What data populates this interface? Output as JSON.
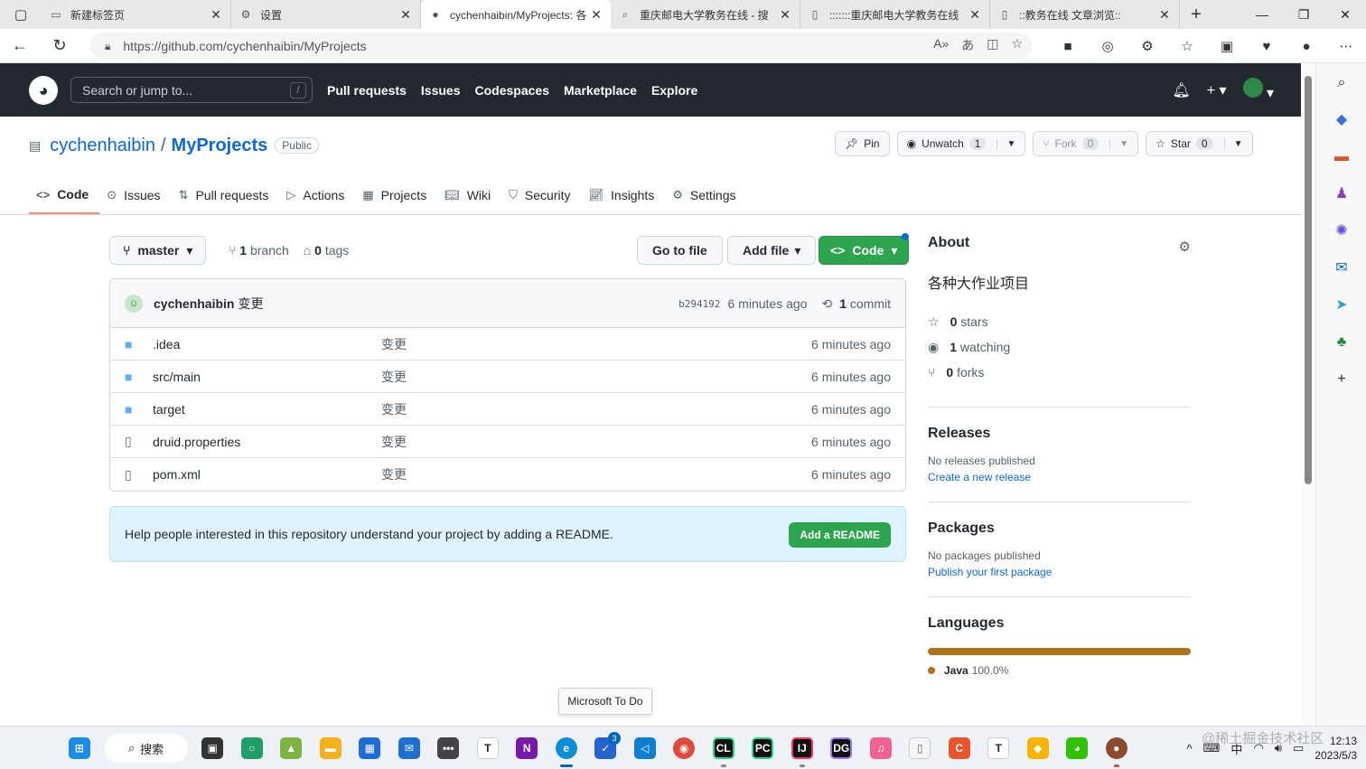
{
  "browser": {
    "tabs": [
      {
        "title": "新建标签页",
        "icon": "newtab-icon",
        "active": false
      },
      {
        "title": "设置",
        "icon": "gear-icon",
        "active": false
      },
      {
        "title": "cychenhaibin/MyProjects: 各",
        "icon": "github-icon",
        "active": true
      },
      {
        "title": "重庆邮电大学教务在线 - 搜",
        "icon": "search-icon",
        "active": false
      },
      {
        "title": ":::::::重庆邮电大学教务在线",
        "icon": "page-icon",
        "active": false
      },
      {
        "title": "::教务在线 文章浏览::",
        "icon": "page-icon",
        "active": false
      }
    ],
    "url": "https://github.com/cychenhaibin/MyProjects"
  },
  "github": {
    "search_placeholder": "Search or jump to...",
    "search_key": "/",
    "nav": [
      "Pull requests",
      "Issues",
      "Codespaces",
      "Marketplace",
      "Explore"
    ],
    "plus_label": "+"
  },
  "repo": {
    "owner": "cychenhaibin",
    "separator": "/",
    "name": "MyProjects",
    "visibility": "Public",
    "pin_label": "Pin",
    "watch_label": "Unwatch",
    "watch_count": "1",
    "fork_label": "Fork",
    "fork_count": "0",
    "star_label": "Star",
    "star_count": "0",
    "tabs": [
      "Code",
      "Issues",
      "Pull requests",
      "Actions",
      "Projects",
      "Wiki",
      "Security",
      "Insights",
      "Settings"
    ]
  },
  "code": {
    "branch": "master",
    "branch_count": "1",
    "branch_label": "branch",
    "tag_count": "0",
    "tag_label": "tags",
    "goto_label": "Go to file",
    "addfile_label": "Add file",
    "code_label": "Code",
    "commit": {
      "author": "cychenhaibin",
      "message": "变更",
      "sha": "b294192",
      "age": "6 minutes ago",
      "count": "1",
      "count_label": "commit"
    },
    "files": [
      {
        "name": ".idea",
        "type": "dir",
        "message": "变更",
        "age": "6 minutes ago"
      },
      {
        "name": "src/main",
        "type": "dir",
        "message": "变更",
        "age": "6 minutes ago"
      },
      {
        "name": "target",
        "type": "dir",
        "message": "变更",
        "age": "6 minutes ago"
      },
      {
        "name": "druid.properties",
        "type": "file",
        "message": "变更",
        "age": "6 minutes ago"
      },
      {
        "name": "pom.xml",
        "type": "file",
        "message": "变更",
        "age": "6 minutes ago"
      }
    ],
    "readme_hint": "Help people interested in this repository understand your project by adding a README.",
    "readme_button": "Add a README"
  },
  "about": {
    "title": "About",
    "description": "各种大作业项目",
    "stars": "0",
    "stars_label": "stars",
    "watching": "1",
    "watching_label": "watching",
    "forks": "0",
    "forks_label": "forks",
    "releases_title": "Releases",
    "releases_text": "No releases published",
    "releases_link": "Create a new release",
    "packages_title": "Packages",
    "packages_text": "No packages published",
    "packages_link": "Publish your first package",
    "languages_title": "Languages",
    "language_name": "Java",
    "language_pct": "100.0%",
    "language_color": "#b07219"
  },
  "tooltip": "Microsoft To Do",
  "taskbar": {
    "search_label": "搜索",
    "todo_badge": "3",
    "ime": "中",
    "time": "12:13",
    "date": "2023/5/3"
  },
  "watermark": "@稀土掘金技术社区"
}
